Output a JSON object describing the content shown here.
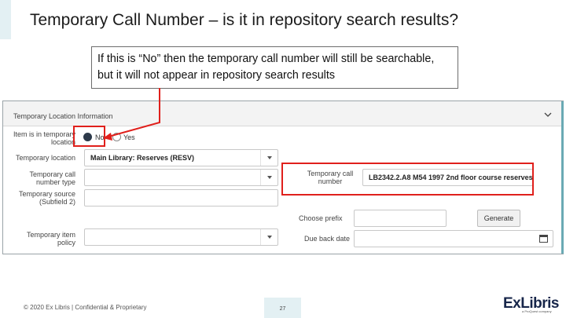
{
  "slide": {
    "title": "Temporary Call Number – is it in repository search results?",
    "callout": "If this is “No” then the temporary call number will still be searchable, but it will not appear in repository search results"
  },
  "form": {
    "section_title": "Temporary Location Information",
    "item_in_temp_location_label": "Item is in temporary location",
    "radio_no_label": "No",
    "radio_yes_label": "Yes",
    "radio_selected": "No",
    "temporary_location_label": "Temporary location",
    "temporary_location_value": "Main Library: Reserves (RESV)",
    "temp_call_number_type_label": "Temporary call number type",
    "temp_call_number_type_value": "",
    "temporary_source_label": "Temporary source (Subfield 2)",
    "temporary_source_value": "",
    "temp_item_policy_label": "Temporary item policy",
    "temp_item_policy_value": "",
    "temp_call_number_label": "Temporary call number",
    "temp_call_number_value": "LB2342.2.A8 M54 1997 2nd floor course reserves",
    "choose_prefix_label": "Choose prefix",
    "choose_prefix_value": "",
    "generate_button": "Generate",
    "due_back_date_label": "Due back date",
    "due_back_date_value": ""
  },
  "footer": {
    "copyright": "© 2020 Ex Libris | Confidential & Proprietary",
    "page_number": "27",
    "logo_text": "ExLibris",
    "logo_subtext": "a ProQuest company"
  },
  "colors": {
    "highlight": "#e0201c",
    "title_accent": "#e3f0f3",
    "logo": "#17264a"
  }
}
